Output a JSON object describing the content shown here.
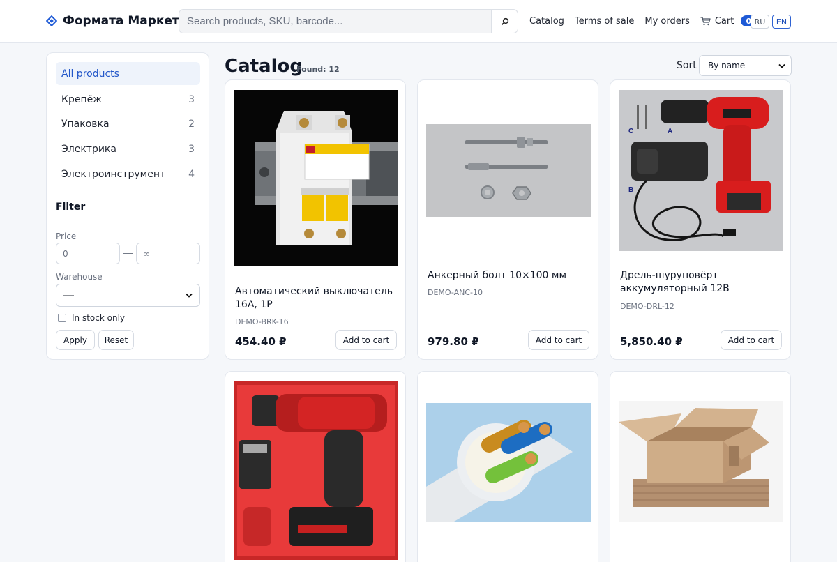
{
  "header": {
    "brand": "Формата Маркет",
    "search_placeholder": "Search products, SKU, barcode...",
    "nav": {
      "catalog": "Catalog",
      "terms": "Terms of sale",
      "orders": "My orders",
      "cart": "Cart",
      "cart_count": "0"
    },
    "langs": [
      "RU",
      "EN"
    ],
    "active_lang": "EN"
  },
  "sidebar": {
    "categories": [
      {
        "label": "All products",
        "count": ""
      },
      {
        "label": "Крепёж",
        "count": "3"
      },
      {
        "label": "Упаковка",
        "count": "2"
      },
      {
        "label": "Электрика",
        "count": "3"
      },
      {
        "label": "Электроинструмент",
        "count": "4"
      }
    ],
    "filter": {
      "title": "Filter",
      "price_label": "Price",
      "price_min": "0",
      "price_max": "∞",
      "warehouse_label": "Warehouse",
      "warehouse_value": "—",
      "in_stock_label": "In stock only",
      "apply": "Apply",
      "reset": "Reset"
    }
  },
  "main": {
    "title": "Catalog",
    "found": "Found: 12",
    "sort_label": "Sort",
    "sort_value": "By name",
    "products": [
      {
        "name": "Автоматический выключатель 16А, 1Р",
        "sku": "DEMO-BRK-16",
        "price": "454.40 ₽",
        "add": "Add to cart",
        "image": "circuit-breaker"
      },
      {
        "name": "Анкерный болт 10×100 мм",
        "sku": "DEMO-ANC-10",
        "price": "979.80 ₽",
        "add": "Add to cart",
        "image": "anchor-bolts"
      },
      {
        "name": "Дрель-шуруповёрт аккумуляторный 12В",
        "sku": "DEMO-DRL-12",
        "price": "5,850.40 ₽",
        "add": "Add to cart",
        "image": "cordless-drill-kit"
      },
      {
        "name": "",
        "sku": "",
        "price": "",
        "add": "",
        "image": "red-drill-case"
      },
      {
        "name": "",
        "sku": "",
        "price": "",
        "add": "",
        "image": "electric-cable"
      },
      {
        "name": "",
        "sku": "",
        "price": "",
        "add": "",
        "image": "cardboard-box"
      }
    ]
  },
  "colors": {
    "accent": "#1e5ad6",
    "active_bg": "#eef3fb",
    "page_bg": "#f5f7fa"
  }
}
